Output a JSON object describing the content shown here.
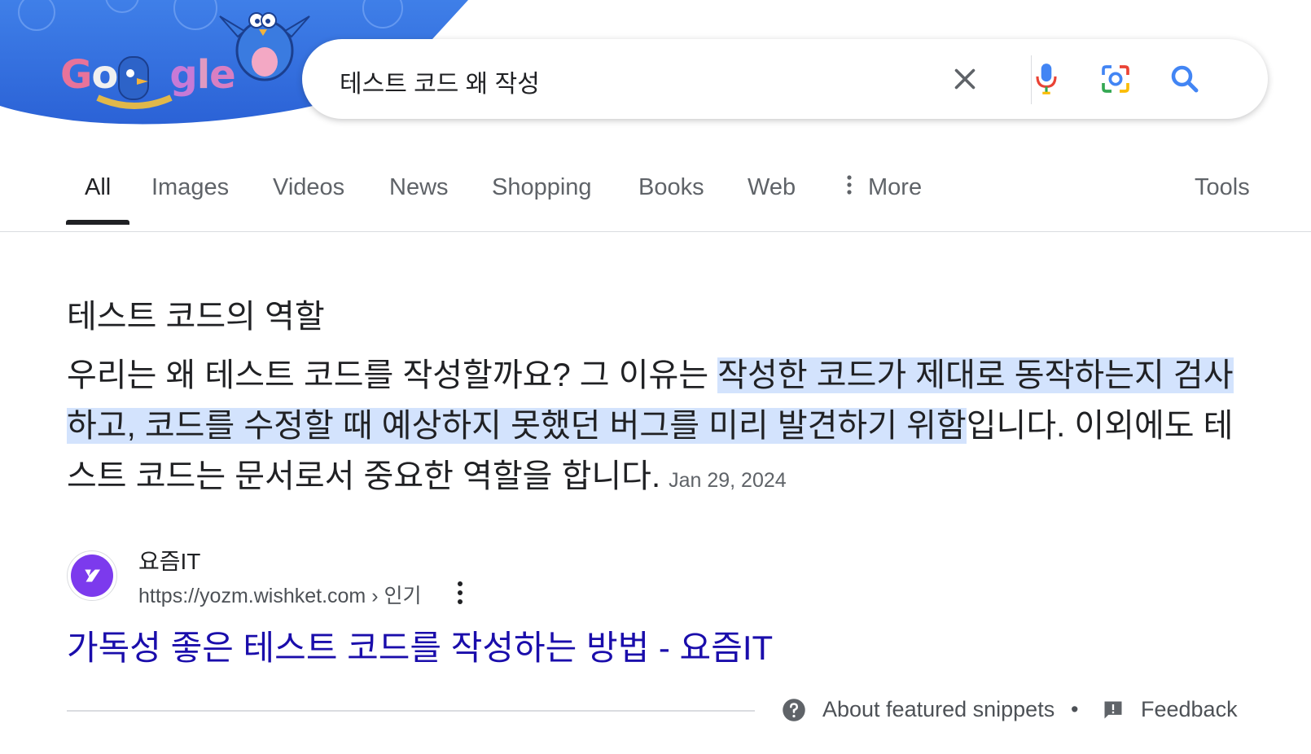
{
  "search": {
    "query": "테스트 코드 왜 작성"
  },
  "doodle": {
    "logo_text": "Google"
  },
  "tabs": [
    {
      "label": "All",
      "active": true
    },
    {
      "label": "Images"
    },
    {
      "label": "Videos"
    },
    {
      "label": "News"
    },
    {
      "label": "Shopping"
    },
    {
      "label": "Books"
    },
    {
      "label": "Web"
    },
    {
      "label": "More"
    }
  ],
  "tools_label": "Tools",
  "snippet": {
    "heading": "테스트 코드의 역할",
    "text_before": "우리는 왜 테스트 코드를 작성할까요? 그 이유는 ",
    "text_highlight": "작성한 코드가 제대로 동작하는지 검사하고, 코드를 수정할 때 예상하지 못했던 버그를 미리 발견하기 위함",
    "text_after": "입니다. 이외에도 테스트 코드는 문서로서 중요한 역할을 합니다.",
    "date": "Jan 29, 2024"
  },
  "source": {
    "site_name": "요즘IT",
    "url": "https://yozm.wishket.com › 인기",
    "title": "가독성 좋은 테스트 코드를 작성하는 방법 - 요즘IT"
  },
  "footer": {
    "about_label": "About featured snippets",
    "separator": "•",
    "feedback_label": "Feedback"
  },
  "colors": {
    "link": "#1a0dab",
    "highlight": "#d3e3fd",
    "doodle_blue": "#2f6fe0"
  }
}
